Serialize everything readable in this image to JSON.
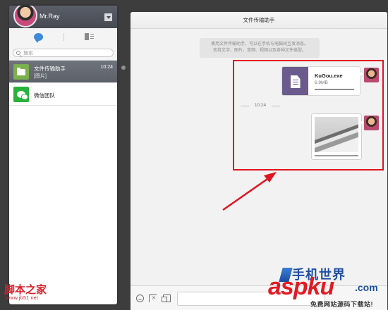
{
  "profile": {
    "name": "Mr.Ray"
  },
  "search": {
    "placeholder": "搜索"
  },
  "chats": [
    {
      "name": "文件传输助手",
      "time": "10:24",
      "preview": "[图片]"
    },
    {
      "name": "微信团队"
    }
  ],
  "conversation": {
    "title": "文件传输助手",
    "notice_line1": "使用文件传输助手，可以在手机与电脑间互发消息。",
    "notice_line2": "支持文字、图片、音频、视频以及各种文件类型。",
    "time_separator": "10:24",
    "file_message": {
      "name": "KuGou.exe",
      "size": "6.9MB",
      "progress": 1.0
    }
  },
  "watermarks": {
    "left_main": "脚本之家",
    "left_sub": "www.jb51.net",
    "right_logo": "手机世界",
    "right_main": "aspku",
    "right_com": ".com",
    "right_sub": "免费网站源码下载站!"
  },
  "colors": {
    "highlight": "#e0141e",
    "file_icon_bg": "#6b5b8c",
    "watermark_red": "#d7202a"
  },
  "icons": [
    "chat-tab-icon",
    "contacts-tab-icon",
    "search-icon",
    "file-doc-icon",
    "emoji-icon",
    "screenshot-icon",
    "send-file-icon"
  ]
}
